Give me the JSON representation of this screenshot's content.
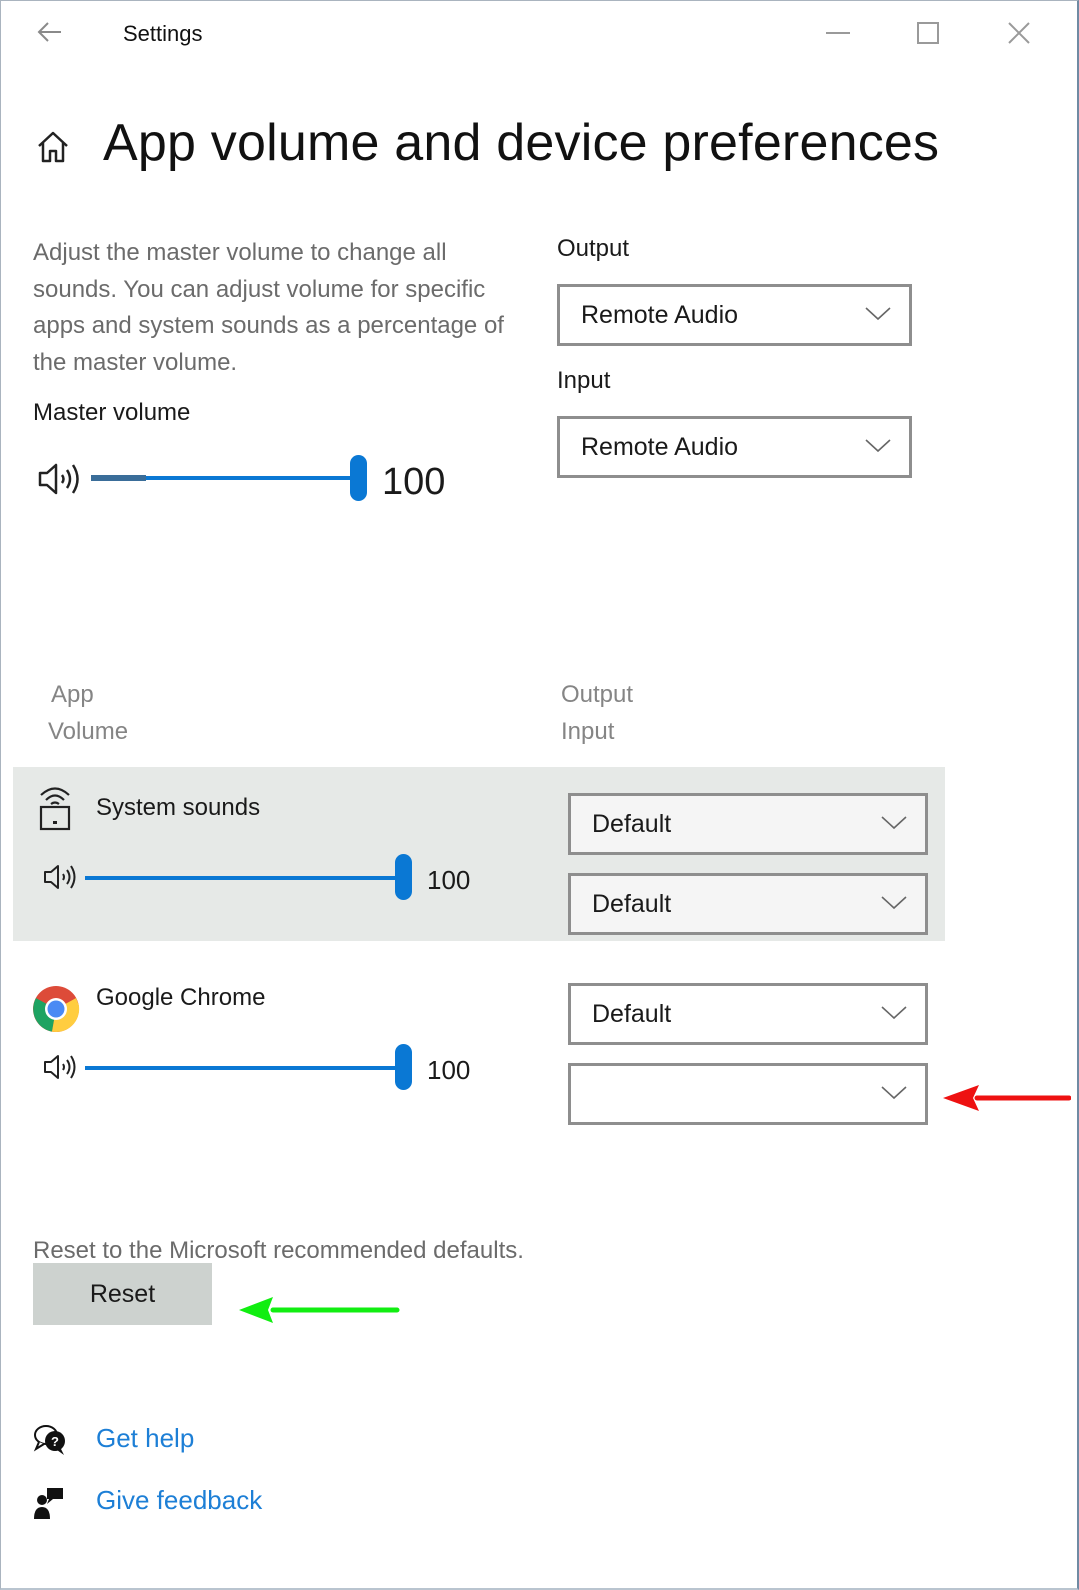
{
  "window": {
    "title": "Settings",
    "controls": {
      "minimize": "minimize-icon",
      "maximize": "maximize-icon",
      "close": "close-icon"
    },
    "back_icon": "back-arrow-icon"
  },
  "header": {
    "home_icon": "home-icon",
    "title": "App volume and device preferences"
  },
  "master": {
    "description": "Adjust the master volume to change all sounds. You can adjust volume for specific apps and system sounds as a percentage of the master volume.",
    "label": "Master volume",
    "volume_icon": "speaker-icon",
    "value": "100",
    "level_percent": 100
  },
  "devices": {
    "output_label": "Output",
    "output_value": "Remote Audio",
    "input_label": "Input",
    "input_value": "Remote Audio"
  },
  "apps_table": {
    "headers": {
      "app": "App",
      "volume": "Volume",
      "output": "Output",
      "input": "Input"
    },
    "rows": [
      {
        "name": "System sounds",
        "icon": "system-sounds-icon",
        "volume": "100",
        "level_percent": 100,
        "output": "Default",
        "input": "Default",
        "highlighted": true
      },
      {
        "name": "Google Chrome",
        "icon": "chrome-icon",
        "volume": "100",
        "level_percent": 100,
        "output": "Default",
        "input": ""
      }
    ]
  },
  "reset": {
    "description": "Reset to the Microsoft recommended defaults.",
    "button_label": "Reset"
  },
  "footer_links": [
    {
      "label": "Get help",
      "icon": "help-icon"
    },
    {
      "label": "Give feedback",
      "icon": "feedback-icon"
    }
  ],
  "annotations": {
    "red_arrow_color": "#ee1111",
    "green_arrow_color": "#11ee11"
  },
  "colors": {
    "accent": "#0a78d4",
    "link": "#1d7fd6",
    "highlight_row": "#e6e9e7"
  }
}
